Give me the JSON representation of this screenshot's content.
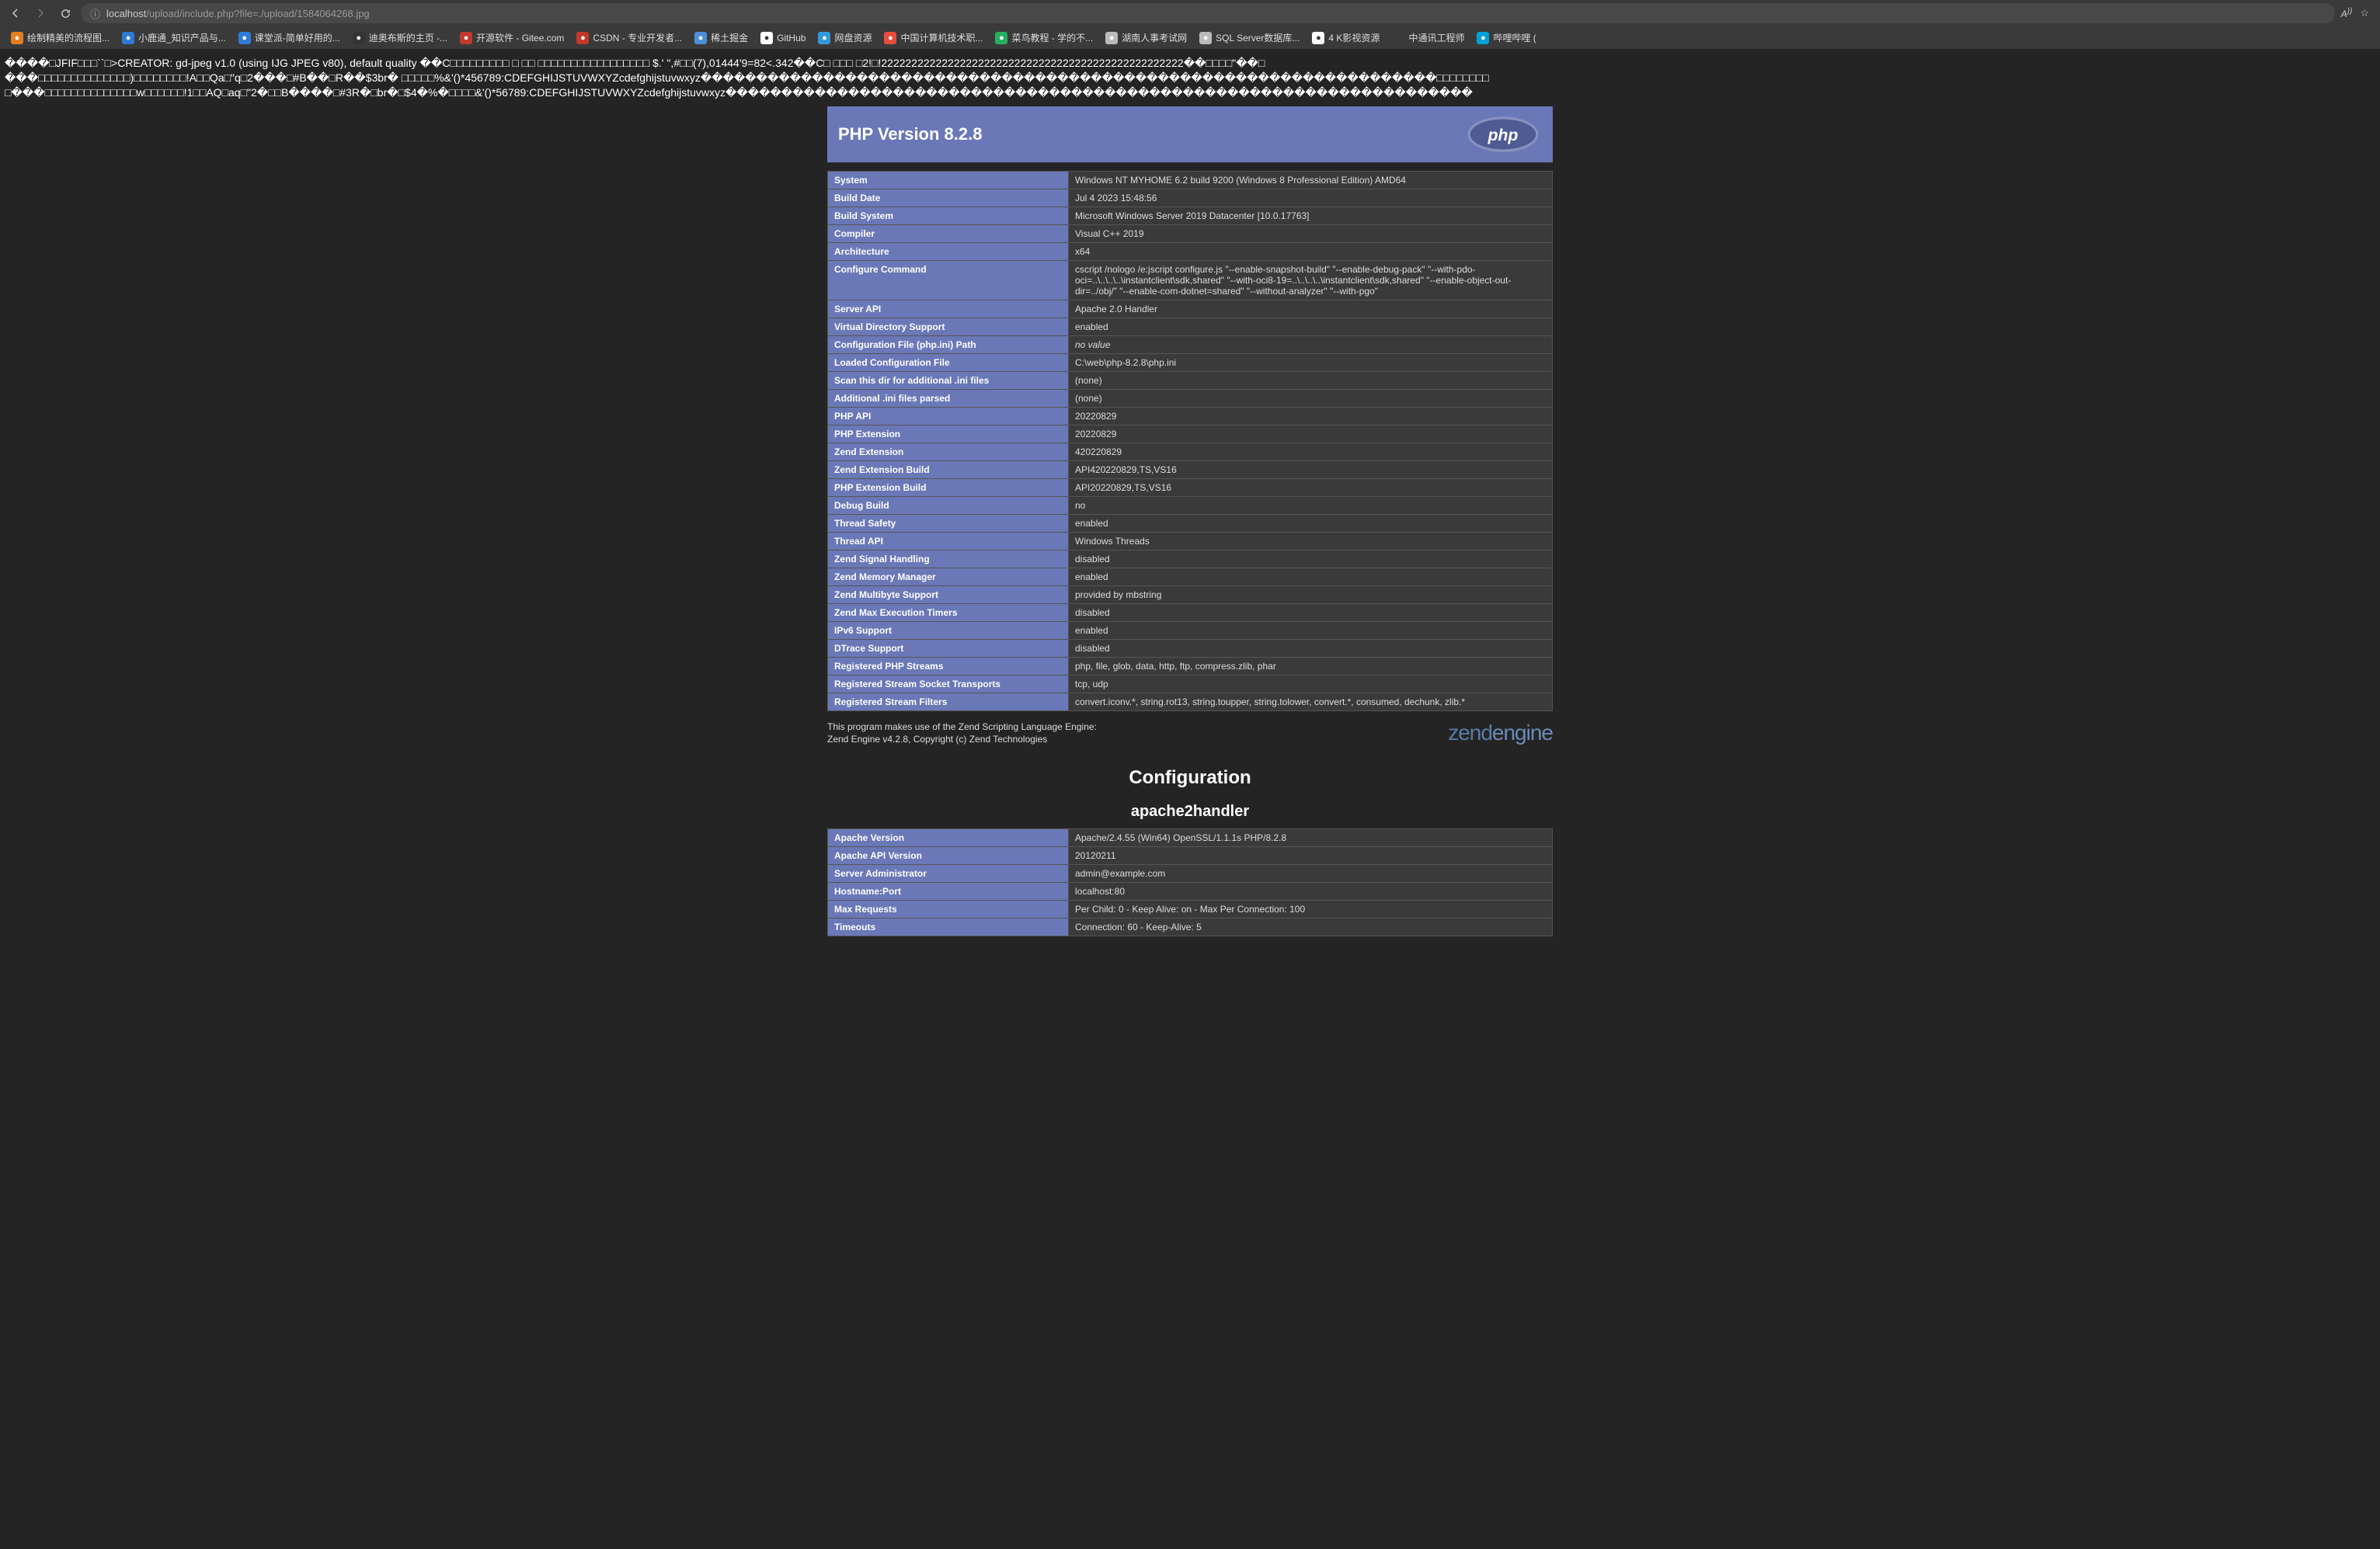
{
  "browser": {
    "url_host": "localhost",
    "url_path": "/upload/include.php?file=./upload/1584064268.jpg"
  },
  "bookmarks": [
    {
      "label": "绘制精美的流程图...",
      "color": "#e67e22"
    },
    {
      "label": "小鹿通_知识产品与...",
      "color": "#2e7bd6"
    },
    {
      "label": "课堂派-简单好用的...",
      "color": "#2e7bd6"
    },
    {
      "label": "迪奥布斯的主页 -...",
      "color": "#333"
    },
    {
      "label": "开源软件 - Gitee.com",
      "color": "#c0392b"
    },
    {
      "label": "CSDN - 专业开发者...",
      "color": "#c0392b"
    },
    {
      "label": "稀土掘金",
      "color": "#4a90d9"
    },
    {
      "label": "GitHub",
      "color": "#fff"
    },
    {
      "label": "网盘资源",
      "color": "#3498db"
    },
    {
      "label": "中国计算机技术职...",
      "color": "#e74c3c"
    },
    {
      "label": "菜鸟教程 - 学的不...",
      "color": "#27ae60"
    },
    {
      "label": "湖南人事考试网",
      "color": "#bbb"
    },
    {
      "label": "SQL Server数据库...",
      "color": "#bbb"
    },
    {
      "label": "4 K影视资源",
      "color": "#fff"
    },
    {
      "label": "中通讯工程师",
      "color": ""
    },
    {
      "label": "哔哩哔哩 (",
      "color": "#00a1d6"
    }
  ],
  "garbage_line1": "����□JFIF□□□``□>CREATOR: gd-jpeg v1.0 (using IJG JPEG v80), default quality ��C□□□□□□□□□ □ □□ □□□□□□□□□□□□□□□□□ $.' \",#□□(7),01444'9=82<.342��C□ □□□ □2!□!22222222222222222222222222222222222222222222222222��□□□□\"��□",
  "garbage_line2": "���□□□□□□□□□□□□□□)□□□□□□□□!A□□Qa□\"q□2���□#B��□R��$3br� □□□□□%&'()*456789:CDEFGHIJSTUVWXYZcdefghijstuvwxyz������������������������������������������������������������������□□□□□□□□",
  "garbage_line3": "□���□□□□□□□□□□□□□□w□□□□□□!1□□AQ□aq□\"2�□□B����□#3R�□br�□$4�%�□□□□&'()*56789:CDEFGHIJSTUVWXYZcdefghijstuvwxyz�������������������������������������������������������������������",
  "php_version": "PHP Version 8.2.8",
  "info_rows": [
    {
      "k": "System",
      "v": "Windows NT MYHOME 6.2 build 9200 (Windows 8 Professional Edition) AMD64"
    },
    {
      "k": "Build Date",
      "v": "Jul 4 2023 15:48:56"
    },
    {
      "k": "Build System",
      "v": "Microsoft Windows Server 2019 Datacenter [10.0.17763]"
    },
    {
      "k": "Compiler",
      "v": "Visual C++ 2019"
    },
    {
      "k": "Architecture",
      "v": "x64"
    },
    {
      "k": "Configure Command",
      "v": "cscript /nologo /e:jscript configure.js \"--enable-snapshot-build\" \"--enable-debug-pack\" \"--with-pdo-oci=..\\..\\..\\..\\instantclient\\sdk,shared\" \"--with-oci8-19=..\\..\\..\\..\\instantclient\\sdk,shared\" \"--enable-object-out-dir=../obj/\" \"--enable-com-dotnet=shared\" \"--without-analyzer\" \"--with-pgo\""
    },
    {
      "k": "Server API",
      "v": "Apache 2.0 Handler"
    },
    {
      "k": "Virtual Directory Support",
      "v": "enabled"
    },
    {
      "k": "Configuration File (php.ini) Path",
      "v": "no value",
      "italic": true
    },
    {
      "k": "Loaded Configuration File",
      "v": "C:\\web\\php-8.2.8\\php.ini"
    },
    {
      "k": "Scan this dir for additional .ini files",
      "v": "(none)"
    },
    {
      "k": "Additional .ini files parsed",
      "v": "(none)"
    },
    {
      "k": "PHP API",
      "v": "20220829"
    },
    {
      "k": "PHP Extension",
      "v": "20220829"
    },
    {
      "k": "Zend Extension",
      "v": "420220829"
    },
    {
      "k": "Zend Extension Build",
      "v": "API420220829,TS,VS16"
    },
    {
      "k": "PHP Extension Build",
      "v": "API20220829,TS,VS16"
    },
    {
      "k": "Debug Build",
      "v": "no"
    },
    {
      "k": "Thread Safety",
      "v": "enabled"
    },
    {
      "k": "Thread API",
      "v": "Windows Threads"
    },
    {
      "k": "Zend Signal Handling",
      "v": "disabled"
    },
    {
      "k": "Zend Memory Manager",
      "v": "enabled"
    },
    {
      "k": "Zend Multibyte Support",
      "v": "provided by mbstring"
    },
    {
      "k": "Zend Max Execution Timers",
      "v": "disabled"
    },
    {
      "k": "IPv6 Support",
      "v": "enabled"
    },
    {
      "k": "DTrace Support",
      "v": "disabled"
    },
    {
      "k": "Registered PHP Streams",
      "v": "php, file, glob, data, http, ftp, compress.zlib, phar"
    },
    {
      "k": "Registered Stream Socket Transports",
      "v": "tcp, udp"
    },
    {
      "k": "Registered Stream Filters",
      "v": "convert.iconv.*, string.rot13, string.toupper, string.tolower, convert.*, consumed, dechunk, zlib.*"
    }
  ],
  "credits_line1": "This program makes use of the Zend Scripting Language Engine:",
  "credits_line2": "Zend Engine v4.2.8, Copyright (c) Zend Technologies",
  "section_title": "Configuration",
  "module_title": "apache2handler",
  "apache_rows": [
    {
      "k": "Apache Version",
      "v": "Apache/2.4.55 (Win64) OpenSSL/1.1.1s PHP/8.2.8"
    },
    {
      "k": "Apache API Version",
      "v": "20120211"
    },
    {
      "k": "Server Administrator",
      "v": "admin@example.com"
    },
    {
      "k": "Hostname:Port",
      "v": "localhost:80"
    },
    {
      "k": "Max Requests",
      "v": "Per Child: 0 - Keep Alive: on - Max Per Connection: 100"
    },
    {
      "k": "Timeouts",
      "v": "Connection: 60 - Keep-Alive: 5"
    }
  ]
}
